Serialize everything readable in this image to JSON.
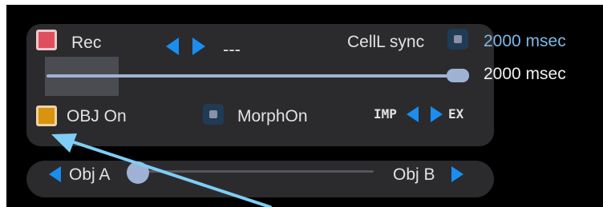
{
  "colors": {
    "panel": "#2b2b2e",
    "accent_blue": "#1a8ef0",
    "slider": "#9fb2d4",
    "rec_red": "#e04e5e",
    "obj_orange": "#d99310",
    "sync_value": "#7fb8e6",
    "annotation_arrow": "#7fcdf5"
  },
  "top": {
    "rec_label": "Rec",
    "preset_value": "---",
    "celll_sync_label": "CellL sync",
    "sync_time": "2000 msec",
    "slider_value_text": "2000 msec",
    "slider_level": 1.0,
    "obj_on_label": "OBJ On",
    "morph_on_label": "MorphOn",
    "imp_label": "IMP",
    "ex_label": "EX"
  },
  "bottom": {
    "obj_a_label": "Obj A",
    "obj_b_label": "Obj B",
    "morph_level": 0.0
  },
  "icons": {
    "rec": "checkbox-checked-red",
    "preset_prev": "triangle-left",
    "preset_next": "triangle-right",
    "sync": "checkbox-unchecked-blue",
    "obj_on": "checkbox-checked-orange",
    "morph": "checkbox-unchecked-blue",
    "imp_ex_left": "triangle-left",
    "imp_ex_right": "triangle-right",
    "obj_a": "triangle-left",
    "obj_b": "triangle-right",
    "annotation": "arrow-pointer"
  }
}
